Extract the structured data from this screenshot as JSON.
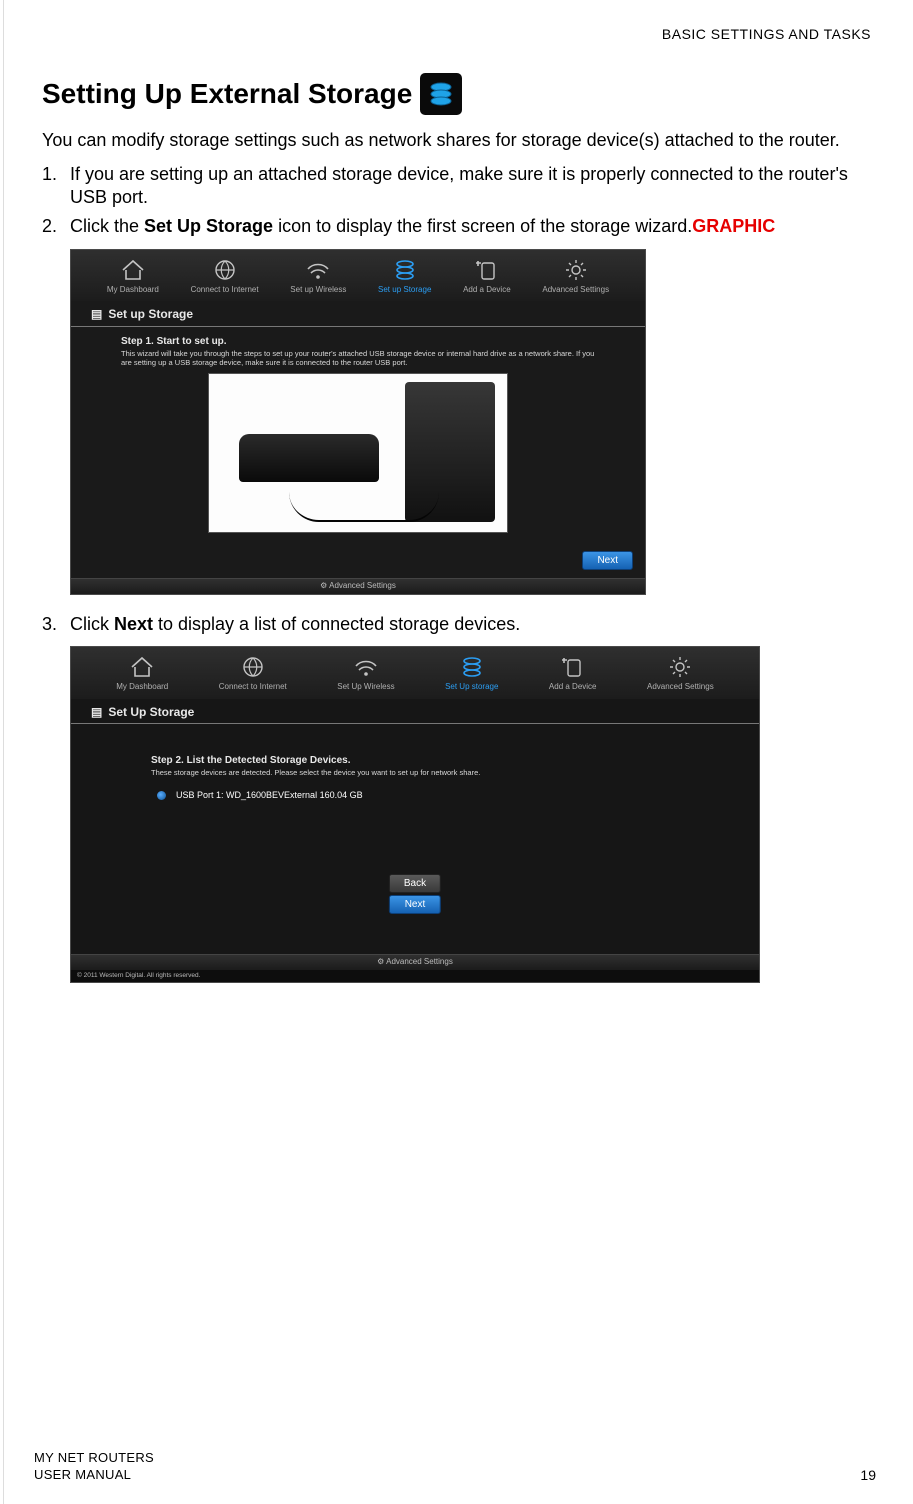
{
  "pageHeader": "BASIC SETTINGS AND TASKS",
  "heading": "Setting Up External Storage",
  "intro": "You can modify storage settings such as network shares for storage device(s) attached to the router.",
  "steps": {
    "s1": {
      "num": "1.",
      "text": "If you are setting up an attached storage device, make sure it is properly connected to the router's USB port."
    },
    "s2": {
      "num": "2.",
      "pre": "Click the ",
      "bold": "Set Up Storage",
      "post": " icon to display the first screen of the storage wizard.",
      "graphic": "GRAPHIC"
    },
    "s3": {
      "num": "3.",
      "pre": "Click ",
      "bold": "Next",
      "post": " to display a list of connected storage devices."
    }
  },
  "shot1": {
    "nav": [
      "My Dashboard",
      "Connect to Internet",
      "Set up Wireless",
      "Set up Storage",
      "Add a Device",
      "Advanced Settings"
    ],
    "activeIdx": 3,
    "panelTitle": "Set up Storage",
    "stepTitle": "Step 1. Start to set up.",
    "stepDesc": "This wizard will take you through the steps to set up your router's attached USB storage device or internal hard drive as a network share. If you are setting up a USB storage device, make sure it is connected to the router USB port.",
    "next": "Next",
    "bottom": "Advanced Settings"
  },
  "shot2": {
    "nav": [
      "My Dashboard",
      "Connect to Internet",
      "Set Up Wireless",
      "Set Up storage",
      "Add a Device",
      "Advanced Settings"
    ],
    "activeIdx": 3,
    "panelTitle": "Set Up Storage",
    "stepTitle": "Step 2. List the Detected Storage Devices.",
    "stepDesc": "These storage devices are detected. Please select the device you want to set up for network share.",
    "device": "USB Port 1:  WD_1600BEVExternal  160.04 GB",
    "back": "Back",
    "next": "Next",
    "bottom": "Advanced Settings",
    "footer": "© 2011 Western Digital. All rights reserved."
  },
  "footer": {
    "line1": "MY NET ROUTERS",
    "line2": "USER MANUAL",
    "pageNum": "19"
  }
}
